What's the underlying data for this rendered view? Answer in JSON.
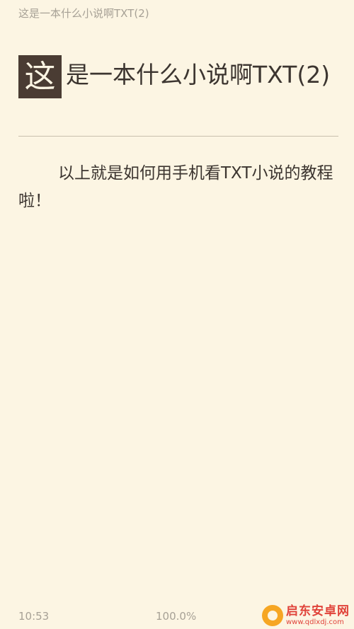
{
  "header": {
    "book_title": "这是一本什么小说啊TXT(2)"
  },
  "chapter": {
    "drop_cap": "这",
    "title_rest": "是一本什么小说啊TXT(2)"
  },
  "content": {
    "paragraph": "以上就是如何用手机看TXT小说的教程啦！"
  },
  "footer": {
    "time": "10:53",
    "progress": "100.0%"
  },
  "watermark": {
    "name": "启东安卓网",
    "url": "www.qdlxdj.com"
  },
  "colors": {
    "background": "#fcf5e3",
    "text": "#3c3530",
    "muted": "#a7a196",
    "drop_cap_bg": "#4a3c33",
    "watermark": "#e0433a"
  }
}
